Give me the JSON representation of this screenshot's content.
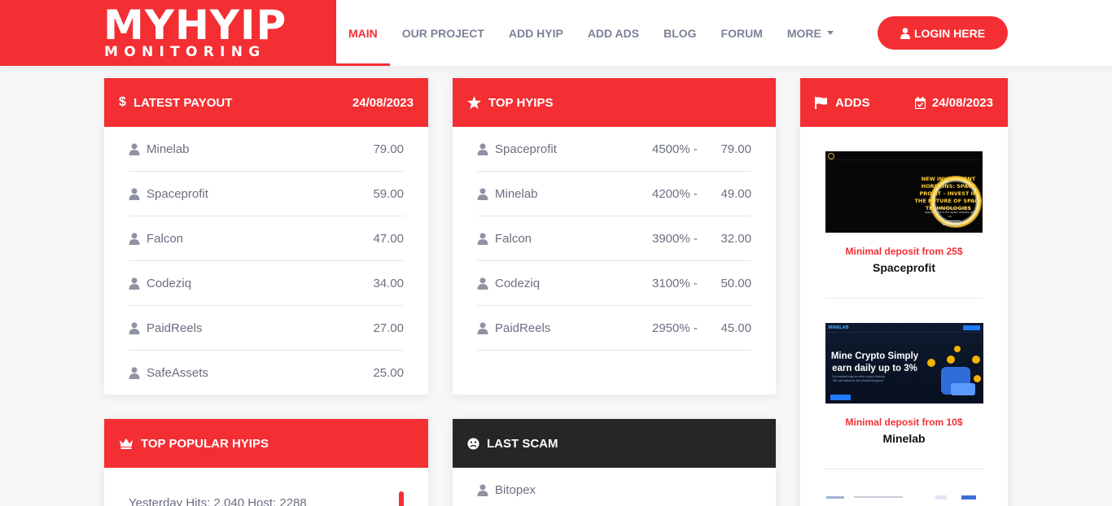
{
  "brand": {
    "line1": "MYHYIP",
    "line2": "MONITORING",
    "color": "#f32f33"
  },
  "nav": [
    {
      "label": "MAIN",
      "active": true
    },
    {
      "label": "OUR PROJECT"
    },
    {
      "label": "ADD HYIP"
    },
    {
      "label": "ADD ADS"
    },
    {
      "label": "BLOG"
    },
    {
      "label": "FORUM"
    },
    {
      "label": "MORE",
      "dropdown": true
    }
  ],
  "login": {
    "label": "LOGIN HERE",
    "icon": "user-icon"
  },
  "latest_payout": {
    "title": "LATEST PAYOUT",
    "icon": "dollar-icon",
    "date": "24/08/2023",
    "rows": [
      {
        "name": "Minelab",
        "value": "79.00"
      },
      {
        "name": "Spaceprofit",
        "value": "59.00"
      },
      {
        "name": "Falcon",
        "value": "47.00"
      },
      {
        "name": "Codeziq",
        "value": "34.00"
      },
      {
        "name": "PaidReels",
        "value": "27.00"
      },
      {
        "name": "SafeAssets",
        "value": "25.00"
      }
    ]
  },
  "top_hyips": {
    "title": "TOP HYIPS",
    "icon": "star-icon",
    "rows": [
      {
        "name": "Spaceprofit",
        "percent": "4500% -",
        "value": "79.00"
      },
      {
        "name": "Minelab",
        "percent": "4200% -",
        "value": "49.00"
      },
      {
        "name": "Falcon",
        "percent": "3900% -",
        "value": "32.00"
      },
      {
        "name": "Codeziq",
        "percent": "3100% -",
        "value": "50.00"
      },
      {
        "name": "PaidReels",
        "percent": "2950% -",
        "value": "45.00"
      }
    ]
  },
  "adds": {
    "title": "ADDS",
    "icon": "flag-icon",
    "date_icon": "calendar-icon",
    "date": "24/08/2023",
    "items": [
      {
        "deposit": "Minimal deposit from 25$",
        "name": "Spaceprofit",
        "banner_headline": "NEW INVESTMENT HORIZONS: SPACE PROFIT – INVEST IN THE FUTURE OF SPACE TECHNOLOGIES",
        "banner_sub": "The most promising investment opportunities in the space industry with us",
        "banner_btn": "START NOW"
      },
      {
        "deposit": "Minimal deposit from 10$",
        "name": "Minelab",
        "banner_brand": "MINELAB",
        "banner_headline": "Mine Crypto Simply earn daily up to 3%",
        "banner_sub": "The easiest way to mine crypto directly. We are based in the United Kingdom."
      }
    ]
  },
  "top_popular": {
    "title": "TOP POPULAR HYIPS",
    "icon": "crown-icon",
    "hits_text": "Yesterday Hits: 2,040 Host: 2288"
  },
  "last_scam": {
    "title": "LAST SCAM",
    "icon": "frown-icon",
    "rows": [
      {
        "name": "Bitopex"
      }
    ]
  }
}
